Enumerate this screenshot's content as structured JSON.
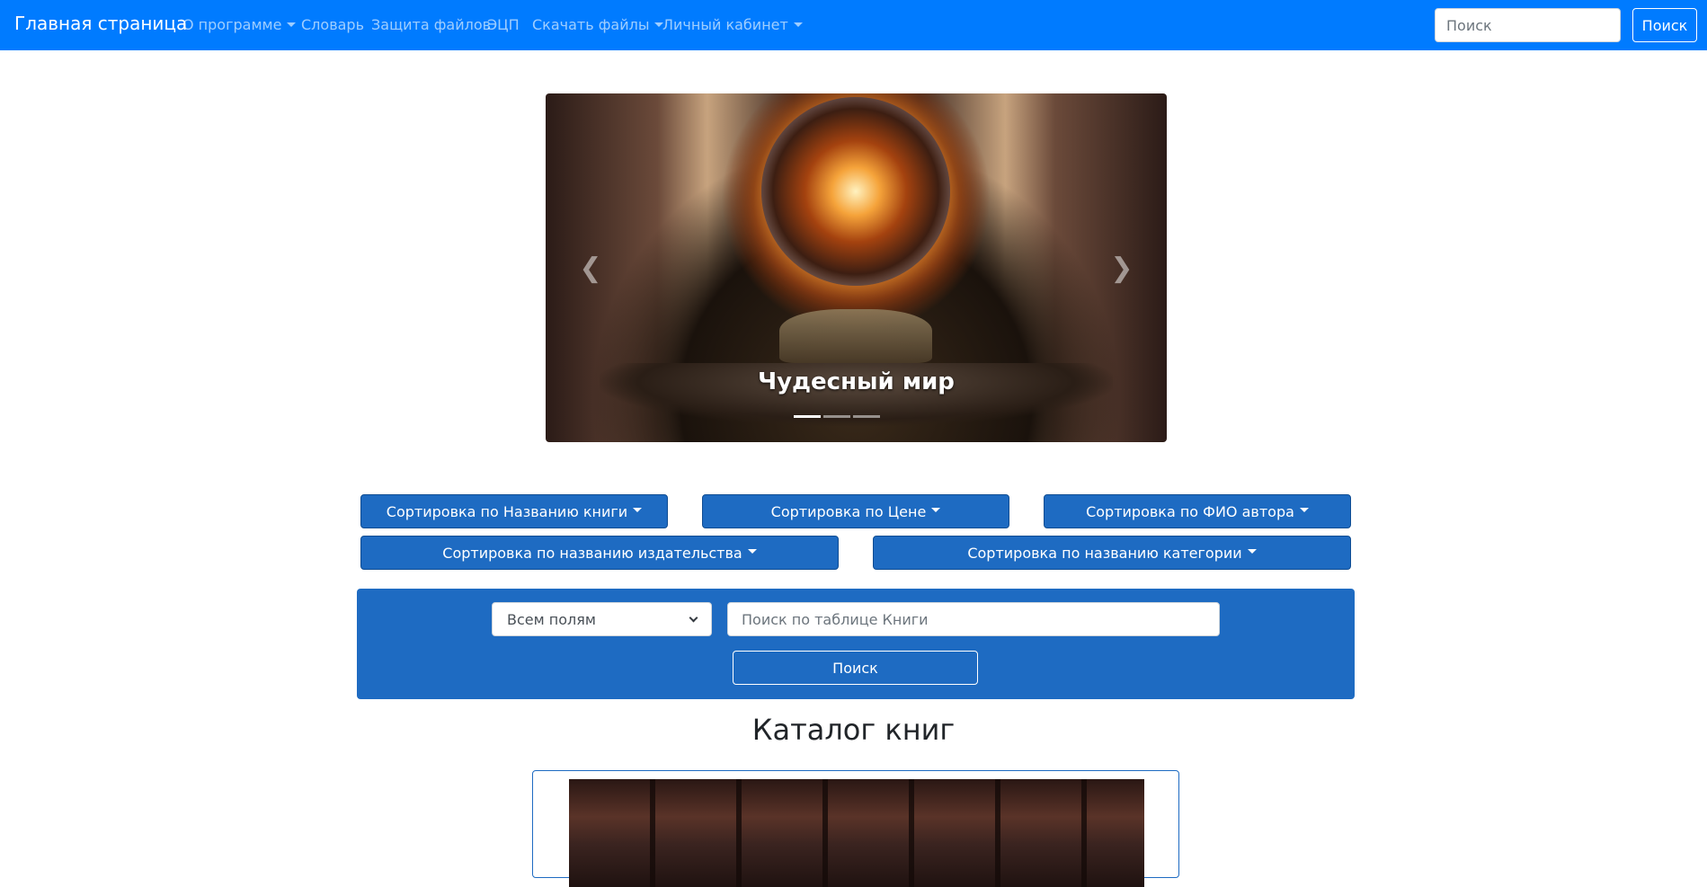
{
  "navbar": {
    "brand": "Главная страница",
    "items": [
      {
        "label": "О программе",
        "dropdown": true
      },
      {
        "label": "Словарь",
        "dropdown": false
      },
      {
        "label": "Защита файлов",
        "dropdown": false
      },
      {
        "label": "ЭЦП",
        "dropdown": false
      },
      {
        "label": "Скачать файлы",
        "dropdown": true
      },
      {
        "label": "Личный кабинет",
        "dropdown": true
      }
    ],
    "search_placeholder": "Поиск",
    "search_button": "Поиск",
    "color": "#007bff"
  },
  "carousel": {
    "caption": "Чудесный мир",
    "prev_icon": "chevron-left-icon",
    "next_icon": "chevron-right-icon",
    "slide_count": 3,
    "active_slide": 1
  },
  "sort_buttons": {
    "by_title": "Сортировка по Названию книги",
    "by_price": "Сортировка по Цене",
    "by_author": "Сортировка по ФИО автора",
    "by_publisher": "Сортировка по названию издательства",
    "by_category": "Сортировка по названию категории",
    "color": "#1e6bc2"
  },
  "search_panel": {
    "field_select_value": "Всем полям",
    "table_search_placeholder": "Поиск по таблице Книги",
    "search_button": "Поиск"
  },
  "catalog": {
    "title": "Каталог книг"
  }
}
